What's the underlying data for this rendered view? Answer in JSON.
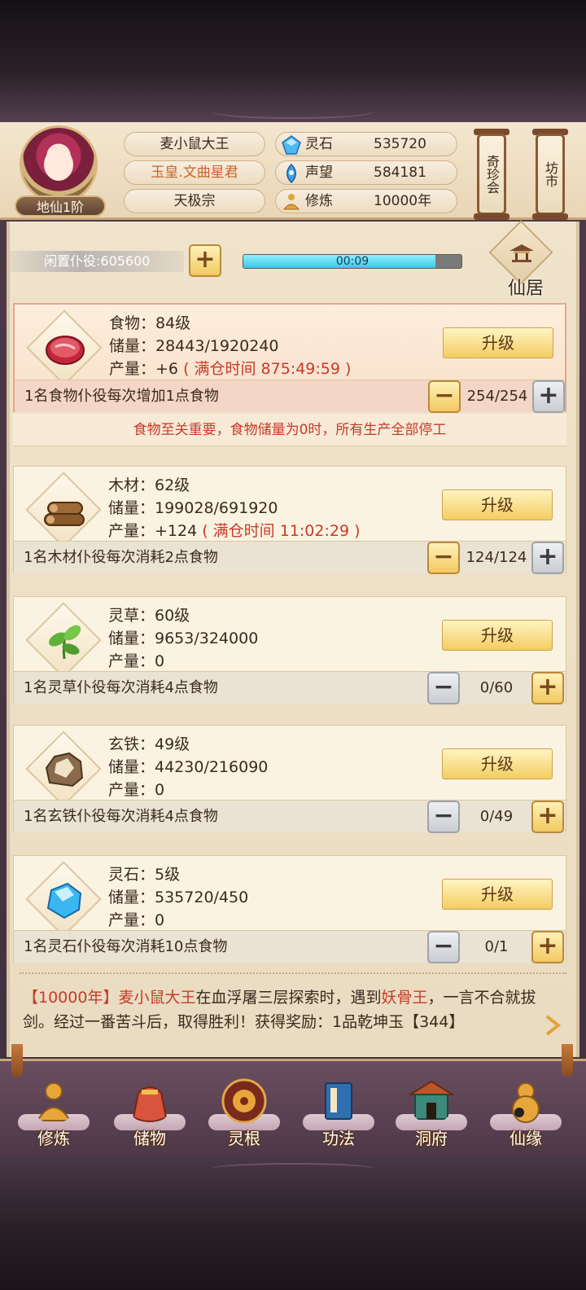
{
  "player": {
    "name": "麦小鼠大王",
    "title": "玉皇.文曲星君",
    "sect": "天极宗",
    "rank": "地仙1阶"
  },
  "stats": {
    "spirit_stone": {
      "label": "灵石",
      "value": "535720"
    },
    "reputation": {
      "label": "声望",
      "value": "584181"
    },
    "cultivation": {
      "label": "修炼",
      "value": "10000年"
    }
  },
  "side_buttons": {
    "treasure_shop": "奇珍会",
    "market": "坊市"
  },
  "idle": {
    "label": "闲置仆役:605600",
    "timer": "00:09",
    "progress": 0.88
  },
  "residence": {
    "label": "仙居"
  },
  "upgrade_label": "升级",
  "resources": [
    {
      "name_line": "食物：84级",
      "storage_line": "储量：28443/1920240",
      "output_line": "产量：+6",
      "full_time": "( 满仓时间 875:49:59 )",
      "worker_desc": "1名食物仆役每次增加1点食物",
      "worker_count": "254/254"
    },
    {
      "name_line": "木材：62级",
      "storage_line": "储量：199028/691920",
      "output_line": "产量：+124",
      "full_time": "( 满仓时间 11:02:29 )",
      "worker_desc": "1名木材仆役每次消耗2点食物",
      "worker_count": "124/124"
    },
    {
      "name_line": "灵草：60级",
      "storage_line": "储量：9653/324000",
      "output_line": "产量：0",
      "full_time": "",
      "worker_desc": "1名灵草仆役每次消耗4点食物",
      "worker_count": "0/60"
    },
    {
      "name_line": "玄铁：49级",
      "storage_line": "储量：44230/216090",
      "output_line": "产量：0",
      "full_time": "",
      "worker_desc": "1名玄铁仆役每次消耗4点食物",
      "worker_count": "0/49"
    },
    {
      "name_line": "灵石：5级",
      "storage_line": "储量：535720/450",
      "output_line": "产量：0",
      "full_time": "",
      "worker_desc": "1名灵石仆役每次消耗10点食物",
      "worker_count": "0/1"
    }
  ],
  "food_warning": "食物至关重要，食物储量为0时，所有生产全部停工",
  "log": {
    "time": "【10000年】",
    "name": "麦小鼠大王",
    "text1": "在血浮屠三层探索时，遇到",
    "enemy": "妖骨王",
    "text2": "，一言不合就拔剑。经过一番苦斗后，取得胜利！获得奖励：1品乾坤玉【344】"
  },
  "nav": [
    {
      "label": "修炼",
      "icon": "meditation-icon"
    },
    {
      "label": "储物",
      "icon": "bag-icon"
    },
    {
      "label": "灵根",
      "icon": "spirit-root-icon"
    },
    {
      "label": "功法",
      "icon": "book-icon"
    },
    {
      "label": "洞府",
      "icon": "cave-icon"
    },
    {
      "label": "仙缘",
      "icon": "gourd-icon"
    }
  ],
  "colors": {
    "accent_red": "#c83a2a",
    "button_gold": "#f3cd62",
    "progress_cyan": "#3fc6ea"
  }
}
